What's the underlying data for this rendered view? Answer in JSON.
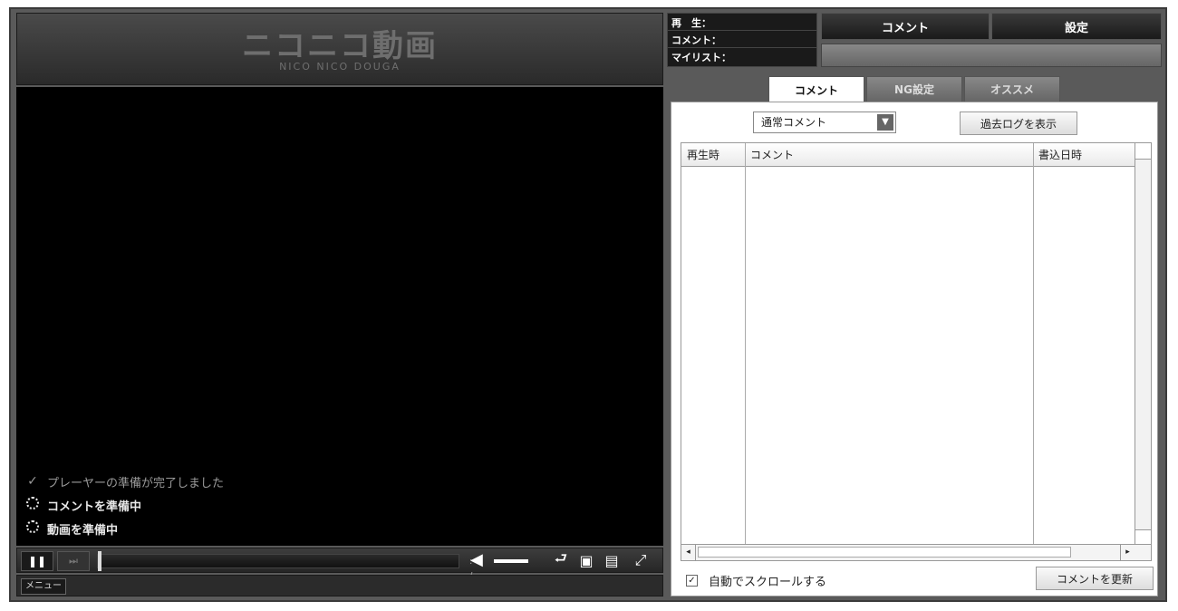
{
  "logo": {
    "main": "ニコニコ動画",
    "sub": "NICO NICO DOUGA"
  },
  "status": {
    "lines": [
      {
        "icon": "checkmark-icon",
        "text": "プレーヤーの準備が完了しました",
        "state": "done"
      },
      {
        "icon": "spinner-icon",
        "text": "コメントを準備中",
        "state": "loading"
      },
      {
        "icon": "spinner-icon",
        "text": "動画を準備中",
        "state": "loading"
      }
    ]
  },
  "controls": {
    "pause_icon": "❚❚",
    "time": ":  /  :",
    "seek_progress": 0,
    "volume_icon": "speaker-icon",
    "repeat_icon": "repeat-icon",
    "comment_toggle_icon": "comment-bubble-icon",
    "screen_icon": "screen-mode-icon",
    "fullscreen_icon": "fullscreen-icon",
    "menu_label": "メニュー"
  },
  "stats": {
    "play_label": "再　生：",
    "comment_label": "コメント：",
    "mylist_label": "マイリスト：",
    "play_value": "",
    "comment_value": "",
    "mylist_value": ""
  },
  "top_buttons": {
    "comment": "コメント",
    "settings": "設定"
  },
  "tabs": [
    {
      "label": "コメント",
      "active": true
    },
    {
      "label": "NG設定",
      "active": false
    },
    {
      "label": "オススメ",
      "active": false
    }
  ],
  "comment_panel": {
    "select_value": "通常コメント",
    "past_log_button": "過去ログを表示",
    "columns": [
      "再生時",
      "コメント",
      "書込日時"
    ],
    "rows": [],
    "autoscroll_label": "自動でスクロールする",
    "autoscroll_checked": true,
    "refresh_button": "コメントを更新"
  },
  "colors": {
    "frame": "#5a5a5a",
    "screen": "#000000",
    "panel": "#ffffff"
  }
}
